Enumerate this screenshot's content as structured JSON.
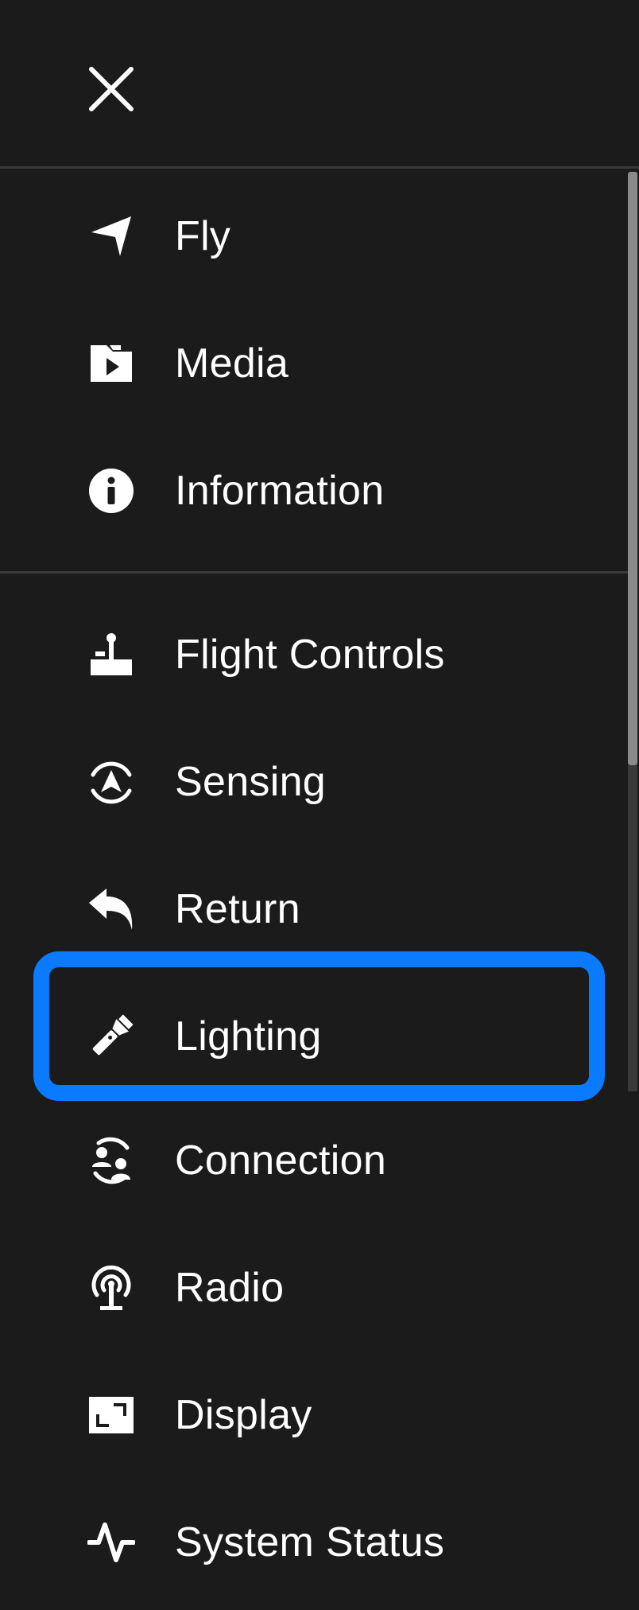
{
  "header": {
    "close_icon": "close-icon"
  },
  "menu": {
    "items": [
      {
        "label": "Fly",
        "icon": "navigation-arrow-icon"
      },
      {
        "label": "Media",
        "icon": "media-folder-icon"
      },
      {
        "label": "Information",
        "icon": "info-icon"
      },
      {
        "label": "Flight Controls",
        "icon": "joystick-icon"
      },
      {
        "label": "Sensing",
        "icon": "sensing-icon"
      },
      {
        "label": "Return",
        "icon": "return-arrow-icon"
      },
      {
        "label": "Lighting",
        "icon": "flashlight-icon"
      },
      {
        "label": "Connection",
        "icon": "connection-users-icon"
      },
      {
        "label": "Radio",
        "icon": "radio-antenna-icon"
      },
      {
        "label": "Display",
        "icon": "display-icon"
      },
      {
        "label": "System Status",
        "icon": "activity-pulse-icon"
      }
    ],
    "selected_label": "Lighting"
  },
  "colors": {
    "background": "#1b1b1b",
    "focus": "#0a7aff",
    "text": "#ffffff",
    "divider": "#3a3a3a"
  }
}
